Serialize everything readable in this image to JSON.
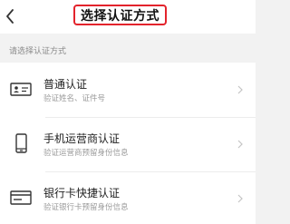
{
  "header": {
    "title": "选择认证方式",
    "back_icon": "chevron-left-icon"
  },
  "section": {
    "hint": "请选择认证方式"
  },
  "methods": [
    {
      "title": "普通认证",
      "subtitle": "验证姓名、证件号",
      "icon": "id-card-icon"
    },
    {
      "title": "手机运营商认证",
      "subtitle": "验证运营商预留身份信息",
      "icon": "mobile-phone-icon"
    },
    {
      "title": "银行卡快捷认证",
      "subtitle": "验证银行卡预留身份信息",
      "icon": "bank-card-icon"
    }
  ],
  "colors": {
    "title_highlight": "#e3232c",
    "background": "#f2f2f2"
  }
}
